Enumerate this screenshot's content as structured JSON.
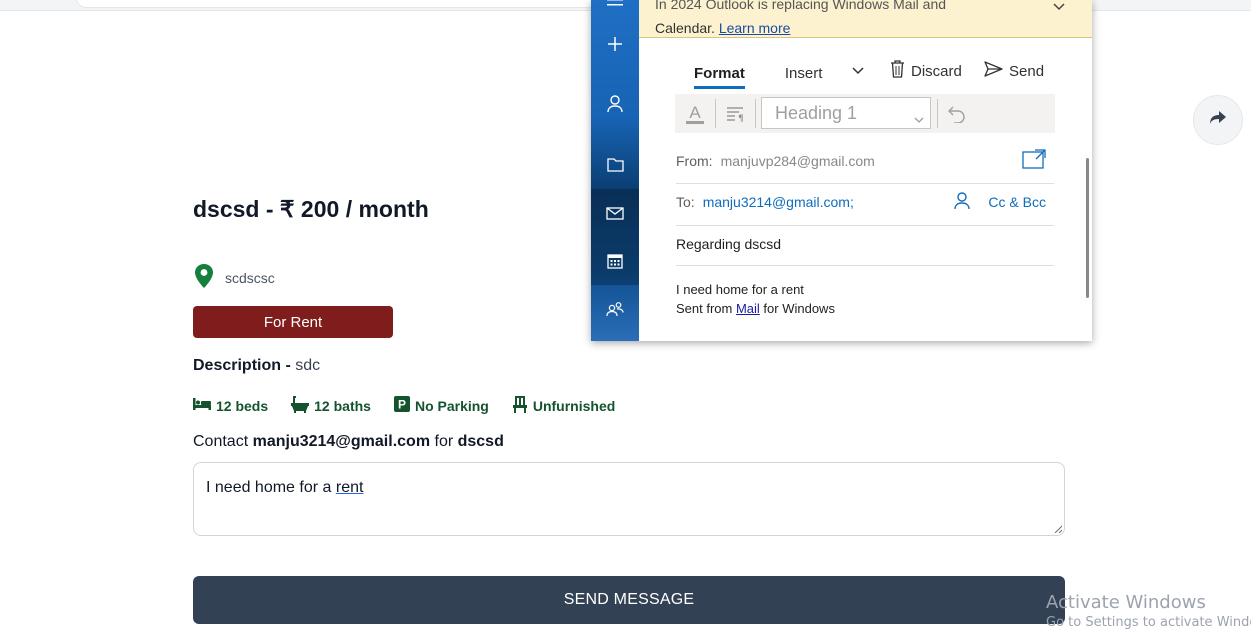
{
  "listing": {
    "title": "dscsd - ₹ 200 / month",
    "location": "scdscsc",
    "status_badge": "For Rent",
    "description_label": "Description - ",
    "description_value": "sdc",
    "amenities": [
      {
        "icon": "bed-icon",
        "label": "12 beds"
      },
      {
        "icon": "bath-icon",
        "label": "12 baths"
      },
      {
        "icon": "parking-icon",
        "label": "No Parking"
      },
      {
        "icon": "chair-icon",
        "label": "Unfurnished"
      }
    ],
    "contact_prefix": "Contact ",
    "contact_email": "manju3214@gmail.com",
    "contact_middle": " for ",
    "contact_listing": "dscsd",
    "message_text_1": "I need home for a ",
    "message_text_2": "rent",
    "send_button": "SEND MESSAGE"
  },
  "mail": {
    "banner_line1": "In 2024 Outlook is replacing Windows Mail and",
    "banner_line2_text": "Calendar. ",
    "banner_link": "Learn more",
    "tabs": [
      "Format",
      "Insert"
    ],
    "actions": {
      "discard": "Discard",
      "send": "Send"
    },
    "style_placeholder": "Heading 1",
    "from_label": "From:",
    "from_value": "manjuvp284@gmail.com",
    "to_label": "To:",
    "to_value": "manju3214@gmail.com;",
    "cc_bcc": "Cc & Bcc",
    "subject": "Regarding dscsd",
    "body_line1": "I need home for a rent",
    "body_line2_prefix": "Sent from ",
    "body_link": "Mail",
    "body_line2_suffix": " for Windows"
  },
  "watermark": {
    "line1": "Activate Windows",
    "line2": "Go to Settings to activate Windows."
  },
  "colors": {
    "badge": "#7f1d1d",
    "send_button": "#334155",
    "amenity_text": "#14532d",
    "location_pin": "#15803d",
    "mail_accent": "#0f6cbd",
    "banner_bg": "#fcf2cf"
  }
}
